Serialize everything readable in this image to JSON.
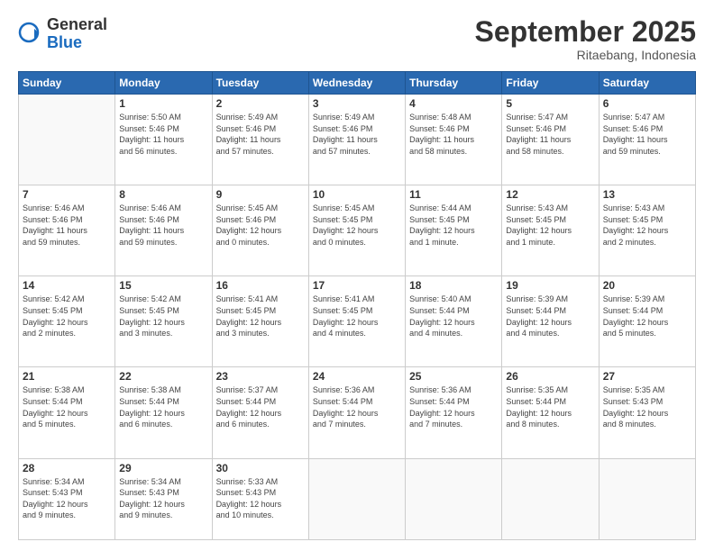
{
  "logo": {
    "general": "General",
    "blue": "Blue"
  },
  "header": {
    "month": "September 2025",
    "location": "Ritaebang, Indonesia"
  },
  "days": [
    "Sunday",
    "Monday",
    "Tuesday",
    "Wednesday",
    "Thursday",
    "Friday",
    "Saturday"
  ],
  "weeks": [
    [
      {
        "day": "",
        "info": ""
      },
      {
        "day": "1",
        "info": "Sunrise: 5:50 AM\nSunset: 5:46 PM\nDaylight: 11 hours\nand 56 minutes."
      },
      {
        "day": "2",
        "info": "Sunrise: 5:49 AM\nSunset: 5:46 PM\nDaylight: 11 hours\nand 57 minutes."
      },
      {
        "day": "3",
        "info": "Sunrise: 5:49 AM\nSunset: 5:46 PM\nDaylight: 11 hours\nand 57 minutes."
      },
      {
        "day": "4",
        "info": "Sunrise: 5:48 AM\nSunset: 5:46 PM\nDaylight: 11 hours\nand 58 minutes."
      },
      {
        "day": "5",
        "info": "Sunrise: 5:47 AM\nSunset: 5:46 PM\nDaylight: 11 hours\nand 58 minutes."
      },
      {
        "day": "6",
        "info": "Sunrise: 5:47 AM\nSunset: 5:46 PM\nDaylight: 11 hours\nand 59 minutes."
      }
    ],
    [
      {
        "day": "7",
        "info": "Sunrise: 5:46 AM\nSunset: 5:46 PM\nDaylight: 11 hours\nand 59 minutes."
      },
      {
        "day": "8",
        "info": "Sunrise: 5:46 AM\nSunset: 5:46 PM\nDaylight: 11 hours\nand 59 minutes."
      },
      {
        "day": "9",
        "info": "Sunrise: 5:45 AM\nSunset: 5:46 PM\nDaylight: 12 hours\nand 0 minutes."
      },
      {
        "day": "10",
        "info": "Sunrise: 5:45 AM\nSunset: 5:45 PM\nDaylight: 12 hours\nand 0 minutes."
      },
      {
        "day": "11",
        "info": "Sunrise: 5:44 AM\nSunset: 5:45 PM\nDaylight: 12 hours\nand 1 minute."
      },
      {
        "day": "12",
        "info": "Sunrise: 5:43 AM\nSunset: 5:45 PM\nDaylight: 12 hours\nand 1 minute."
      },
      {
        "day": "13",
        "info": "Sunrise: 5:43 AM\nSunset: 5:45 PM\nDaylight: 12 hours\nand 2 minutes."
      }
    ],
    [
      {
        "day": "14",
        "info": "Sunrise: 5:42 AM\nSunset: 5:45 PM\nDaylight: 12 hours\nand 2 minutes."
      },
      {
        "day": "15",
        "info": "Sunrise: 5:42 AM\nSunset: 5:45 PM\nDaylight: 12 hours\nand 3 minutes."
      },
      {
        "day": "16",
        "info": "Sunrise: 5:41 AM\nSunset: 5:45 PM\nDaylight: 12 hours\nand 3 minutes."
      },
      {
        "day": "17",
        "info": "Sunrise: 5:41 AM\nSunset: 5:45 PM\nDaylight: 12 hours\nand 4 minutes."
      },
      {
        "day": "18",
        "info": "Sunrise: 5:40 AM\nSunset: 5:44 PM\nDaylight: 12 hours\nand 4 minutes."
      },
      {
        "day": "19",
        "info": "Sunrise: 5:39 AM\nSunset: 5:44 PM\nDaylight: 12 hours\nand 4 minutes."
      },
      {
        "day": "20",
        "info": "Sunrise: 5:39 AM\nSunset: 5:44 PM\nDaylight: 12 hours\nand 5 minutes."
      }
    ],
    [
      {
        "day": "21",
        "info": "Sunrise: 5:38 AM\nSunset: 5:44 PM\nDaylight: 12 hours\nand 5 minutes."
      },
      {
        "day": "22",
        "info": "Sunrise: 5:38 AM\nSunset: 5:44 PM\nDaylight: 12 hours\nand 6 minutes."
      },
      {
        "day": "23",
        "info": "Sunrise: 5:37 AM\nSunset: 5:44 PM\nDaylight: 12 hours\nand 6 minutes."
      },
      {
        "day": "24",
        "info": "Sunrise: 5:36 AM\nSunset: 5:44 PM\nDaylight: 12 hours\nand 7 minutes."
      },
      {
        "day": "25",
        "info": "Sunrise: 5:36 AM\nSunset: 5:44 PM\nDaylight: 12 hours\nand 7 minutes."
      },
      {
        "day": "26",
        "info": "Sunrise: 5:35 AM\nSunset: 5:44 PM\nDaylight: 12 hours\nand 8 minutes."
      },
      {
        "day": "27",
        "info": "Sunrise: 5:35 AM\nSunset: 5:43 PM\nDaylight: 12 hours\nand 8 minutes."
      }
    ],
    [
      {
        "day": "28",
        "info": "Sunrise: 5:34 AM\nSunset: 5:43 PM\nDaylight: 12 hours\nand 9 minutes."
      },
      {
        "day": "29",
        "info": "Sunrise: 5:34 AM\nSunset: 5:43 PM\nDaylight: 12 hours\nand 9 minutes."
      },
      {
        "day": "30",
        "info": "Sunrise: 5:33 AM\nSunset: 5:43 PM\nDaylight: 12 hours\nand 10 minutes."
      },
      {
        "day": "",
        "info": ""
      },
      {
        "day": "",
        "info": ""
      },
      {
        "day": "",
        "info": ""
      },
      {
        "day": "",
        "info": ""
      }
    ]
  ]
}
